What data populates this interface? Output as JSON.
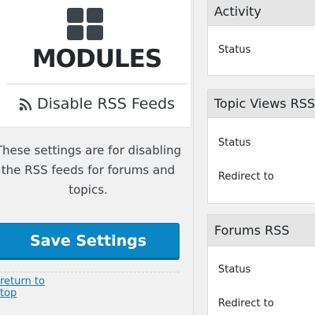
{
  "sidebar": {
    "section_title": "MODULES",
    "icon": "grid-icon",
    "module_icon": "rss-icon",
    "module_title": "Disable RSS Feeds",
    "description": "These settings are for disabling the RSS feeds for forums and topics.",
    "save_button": "Save Settings",
    "return_link": "return to top"
  },
  "settings_boxes": [
    {
      "title": "Activity",
      "rows": [
        "Status"
      ]
    },
    {
      "title": "Topic Views RSS",
      "rows": [
        "Status",
        "Redirect to"
      ]
    },
    {
      "title": "Forums RSS",
      "rows": [
        "Status",
        "Redirect to"
      ]
    }
  ],
  "colors": {
    "primary_button": "#0a86c4",
    "link": "#2271b1",
    "page_background": "#f1f1f1"
  }
}
